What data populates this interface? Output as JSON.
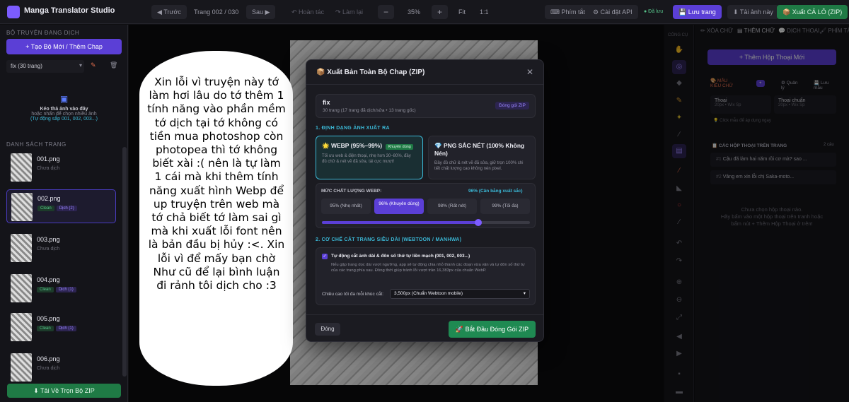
{
  "app": {
    "title": "Manga Translator Studio"
  },
  "toolbar": {
    "prev": "◀ Trước",
    "page": "Trang 002 / 030",
    "next": "Sau ▶",
    "undo": "↶ Hoàn tác",
    "redo": "↷ Làm lại",
    "minus": "−",
    "zoom": "35%",
    "plus": "+",
    "fit": "Fit",
    "one": "1:1",
    "shortcuts": "⌨ Phím tắt",
    "api": "⚙ Cài đặt API",
    "saved": "● Đã lưu",
    "save": "💾 Lưu trang",
    "download": "⬇ Tải ảnh này",
    "export": "📦 Xuất CẢ LÔ (ZIP)"
  },
  "left": {
    "section1": "BỘ TRUYỆN ĐANG DỊCH",
    "create": "+ Tạo Bộ Mới / Thêm Chap",
    "series": "fix (30 trang)",
    "drop_title": "Kéo thả ảnh vào đây",
    "drop_sub": "hoặc nhấn để chọn nhiều ảnh",
    "drop_hint": "(Tự động sắp 001, 002, 003...)",
    "section2": "DANH SÁCH TRANG",
    "pages": [
      {
        "name": "001.png",
        "status": "Chưa dịch",
        "clean": "",
        "done": ""
      },
      {
        "name": "002.png",
        "status": "",
        "clean": "Clean",
        "done": "Dịch (2)"
      },
      {
        "name": "003.png",
        "status": "Chưa dịch",
        "clean": "",
        "done": ""
      },
      {
        "name": "004.png",
        "status": "",
        "clean": "Clean",
        "done": "Dịch (1)"
      },
      {
        "name": "005.png",
        "status": "",
        "clean": "Clean",
        "done": "Dịch (1)"
      },
      {
        "name": "006.png",
        "status": "Chưa dịch",
        "clean": "",
        "done": ""
      }
    ],
    "download_all": "⬇ Tải Về Trọn Bộ ZIP"
  },
  "bubble_text": "Xin lỗi vì truyện này tớ làm hơi lâu do tớ thêm 1 tính năng vào phần mềm tớ dịch tại tớ không có tiền mua photoshop còn photopea thì tớ không biết xài :( nên là tự làm 1 cái mà khi thêm tính năng xuất hình Webp để up truyện trên web mà tớ chả biết tớ làm sai gì mà khi xuất lỗi font nên là bản đầu bị hủy :<. Xin lỗi vì để mấy bạn chờ Như cũ để lại bình luận đi rảnh tôi dịch cho :3",
  "tools": {
    "title": "CÔNG CỤ"
  },
  "right": {
    "tab1": "✏ XÓA CHỮ",
    "tab2": "▤ THÊM CHỮ",
    "tab3": "💬 DỊCH THOẠI",
    "tab4": "🖌 PHÍM TẮT",
    "add": "+ Thêm Hộp Thoại Mới",
    "style_label": "🎨 MẪU KIỂU CHỮ",
    "mgr": "⚙ Quản lý",
    "save_style": "💾 Lưu mẫu",
    "st1": "Thoại",
    "st1s": "20px • Wix Sp",
    "st2": "Thoại chuẩn",
    "st2s": "20px • Wix Sp",
    "hint": "💡 Click mẫu để áp dụng ngay",
    "list_label": "📋 CÁC HỘP THOẠI TRÊN TRANG",
    "count": "2 câu",
    "line1": "Cậu đã làm hai năm rồi cơ mà? sao ...",
    "line2": "Vâng em xin lỗi chị Saka-moto...",
    "empty": "Chưa chọn hộp thoại nào.",
    "empty2": "Hãy bấm vào một hộp thoại trên tranh hoặc",
    "empty3": "bấm nút + Thêm Hộp Thoại ở trên!"
  },
  "modal": {
    "title": "📦 Xuất Bản Toàn Bộ Chap (ZIP)",
    "close": "✕",
    "series": "fix",
    "series_sub": "30 trang (17 trang đã dịch/sửa • 13 trang gốc)",
    "pack": "Đóng gói ZIP",
    "s1": "1. ĐỊNH DẠNG ẢNH XUẤT RA",
    "webp_title": "🌟 WEBP (95%–99%)",
    "webp_badge": "Khuyên dùng",
    "webp_desc": "Tối ưu web & điện thoại, nhẹ hơn 30–80%, đầy đủ chữ & nét vẽ đã sửa, tải cực mượt!",
    "png_title": "💎 PNG SẮC NÉT (100% Không Nén)",
    "png_desc": "Đầy đủ chữ & nét vẽ đã sửa, giữ trọn 100% chi tiết chất lượng cao không nén pixel.",
    "quality_label": "MỨC CHẤT LƯỢNG WEBP:",
    "quality_value": "96% (Cân bằng xuất sắc)",
    "q1": "95% (Nhẹ nhất)",
    "q2": "96% (Khuyên dùng)",
    "q3": "98% (Rất nét)",
    "q4": "99% (Tối đa)",
    "quality_fraction": 0.75,
    "s2": "2. CƠ CHẾ CẮT TRANG SIÊU DÀI (WEBTOON / MANHWA)",
    "auto_title": "Tự động cắt ảnh dài & đôn số thứ tự liền mạch (001, 002, 003...)",
    "auto_desc": "Nếu gặp trang dọc dài vượt ngưỡng, app sẽ tự động chia nhỏ thành các đoạn vừa vặn và tự đôn số thứ tự của các trang phía sau. Đồng thời giúp tránh lỗi vượt trần 16,383px của chuẩn WebP.",
    "height_label": "Chiều cao tối đa mỗi khúc cắt:",
    "height_value": "3,500px (Chuẩn Webtoon mobile)",
    "close_btn": "Đóng",
    "start": "🚀 Bắt Đầu Đóng Gói ZIP"
  },
  "colors": {
    "accent": "#5b3fd6",
    "green": "#1f8a52",
    "cyan": "#3bb8d6"
  }
}
